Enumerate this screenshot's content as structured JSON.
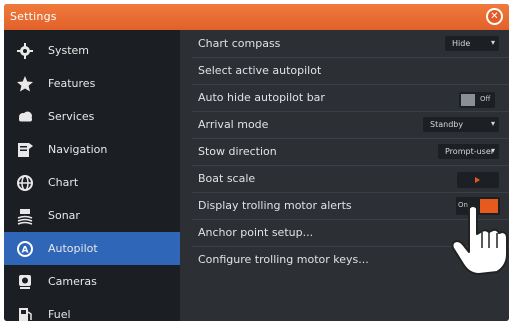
{
  "window": {
    "title": "Settings"
  },
  "sidebar": {
    "items": [
      {
        "label": "System",
        "icon": "gear-icon"
      },
      {
        "label": "Features",
        "icon": "star-icon"
      },
      {
        "label": "Services",
        "icon": "cloud-icon"
      },
      {
        "label": "Navigation",
        "icon": "navigation-icon"
      },
      {
        "label": "Chart",
        "icon": "globe-icon"
      },
      {
        "label": "Sonar",
        "icon": "sonar-icon"
      },
      {
        "label": "Autopilot",
        "icon": "autopilot-icon",
        "active": true
      },
      {
        "label": "Cameras",
        "icon": "camera-icon"
      },
      {
        "label": "Fuel",
        "icon": "fuel-icon"
      }
    ]
  },
  "settings": {
    "chart_compass": {
      "label": "Chart compass",
      "value": "Hide"
    },
    "select_active_autopilot": {
      "label": "Select active autopilot"
    },
    "auto_hide_autopilot_bar": {
      "label": "Auto hide autopilot bar",
      "state": "Off"
    },
    "arrival_mode": {
      "label": "Arrival mode",
      "value": "Standby"
    },
    "stow_direction": {
      "label": "Stow direction",
      "value": "Prompt-user"
    },
    "boat_scale": {
      "label": "Boat scale"
    },
    "display_trolling_motor_alerts": {
      "label": "Display trolling motor alerts",
      "state": "On"
    },
    "anchor_point_setup": {
      "label": "Anchor point setup..."
    },
    "configure_trolling_motor_keys": {
      "label": "Configure trolling motor keys..."
    }
  },
  "colors": {
    "accent": "#e65a1f",
    "active_item": "#2f66b8",
    "panel": "#2c3035",
    "sidebar": "#1b1e22"
  }
}
